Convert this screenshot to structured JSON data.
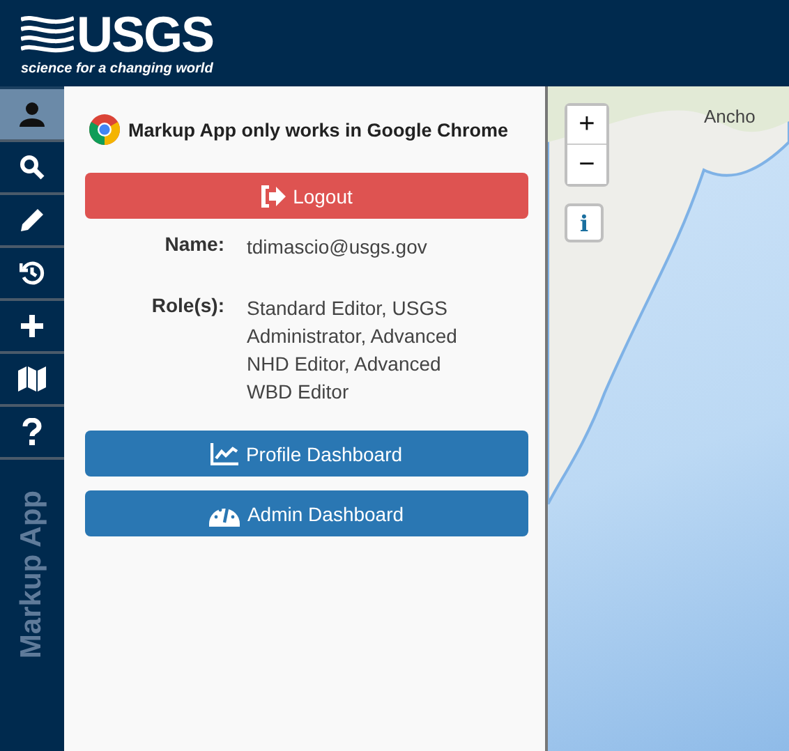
{
  "header": {
    "logo_text": "USGS",
    "tagline": "science for a changing world"
  },
  "sidebar": {
    "items": [
      {
        "kind": "user",
        "selected": true
      },
      {
        "kind": "search",
        "selected": false
      },
      {
        "kind": "pencil",
        "selected": false
      },
      {
        "kind": "history",
        "selected": false
      },
      {
        "kind": "plus",
        "selected": false
      },
      {
        "kind": "map",
        "selected": false
      },
      {
        "kind": "help",
        "selected": false
      }
    ],
    "title": "Markup App"
  },
  "panel": {
    "notice": "Markup App only works in Google Chrome",
    "logout": "Logout",
    "fields": [
      {
        "label": "Name:",
        "value": "tdimascio@usgs.gov"
      },
      {
        "label": "Role(s):",
        "value": "Standard Editor, USGS Administrator, Advanced NHD Editor, Advanced WBD Editor"
      }
    ],
    "buttons": [
      {
        "kind": "profile",
        "label": "Profile Dashboard"
      },
      {
        "kind": "admin",
        "label": "Admin Dashboard"
      }
    ]
  },
  "map": {
    "zoom_in": "+",
    "zoom_out": "−",
    "info": "i",
    "place_label": "Ancho"
  }
}
